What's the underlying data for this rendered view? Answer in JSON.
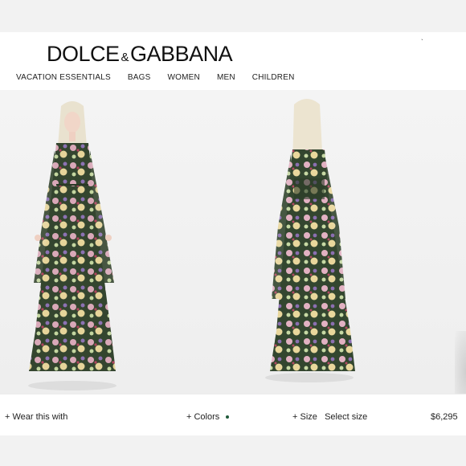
{
  "brand": {
    "name_left": "DOLCE",
    "ampersand": "&",
    "name_right": "GABBANA"
  },
  "nav": {
    "items": [
      "VACATION ESSENTIALS",
      "BAGS",
      "WOMEN",
      "MEN",
      "CHILDREN"
    ]
  },
  "gallery": {
    "images": [
      {
        "view": "front",
        "subject": "model-front"
      },
      {
        "view": "back",
        "subject": "model-back"
      }
    ],
    "dress_colors": [
      "#2e3f2c",
      "#d9b3c2",
      "#e8d9a0",
      "#8c6fb0"
    ]
  },
  "bottom_bar": {
    "wear_label": "+ Wear this with",
    "colors_label": "+ Colors",
    "size_label": "+ Size",
    "size_value": "Select size",
    "price": "$6,295",
    "color_swatch": "#1f5a3a"
  }
}
